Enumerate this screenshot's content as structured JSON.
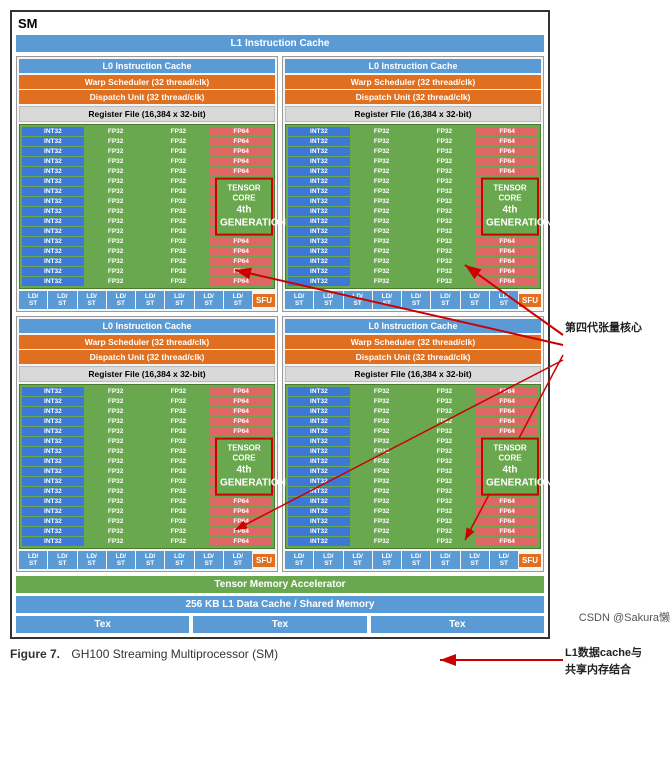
{
  "title": "SM",
  "l1_instruction_cache": "L1 Instruction Cache",
  "l0_instruction_cache": "L0 Instruction Cache",
  "warp_scheduler": "Warp Scheduler (32 thread/clk)",
  "dispatch_unit": "Dispatch Unit (32 thread/clk)",
  "register_file": "Register File (16,384 x 32-bit)",
  "tensor_core_label": "TENSOR CORE",
  "tensor_core_gen": "4th GENERATION",
  "tma_bar": "Tensor Memory Accelerator",
  "data_cache_bar": "256 KB L1 Data Cache / Shared Memory",
  "tex": "Tex",
  "sfu": "SFU",
  "ld_st": "LD/\nST",
  "core_types": [
    "INT32",
    "FP32",
    "FP32",
    "FP64"
  ],
  "figure_number": "Figure 7.",
  "figure_title": "GH100 Streaming Multiprocessor (SM)",
  "annotation_1": "第四代张量核心",
  "annotation_2": "L1数据cache与\n共享内存结合",
  "csdn_watermark": "CSDN @Sakura懒"
}
